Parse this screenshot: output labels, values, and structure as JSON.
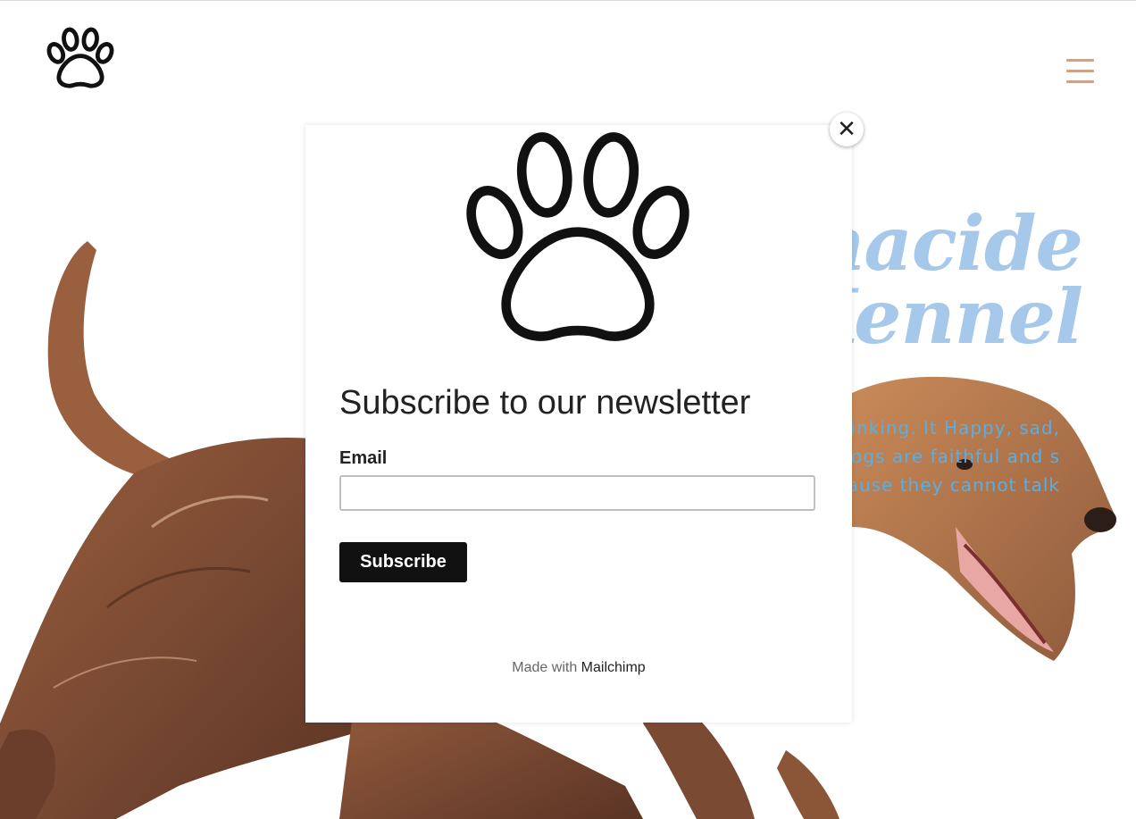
{
  "header": {
    "logo_icon": "paw-icon",
    "menu_icon": "hamburger-menu-icon",
    "menu_color": "#c9a48a"
  },
  "hero": {
    "title": "macide\nKennel",
    "description": "at a dog is thinking. It Happy, sad, cross, and , dogs are faithful and s because they cannot talk",
    "title_color": "#a6c8ea",
    "text_color": "#5aaee0"
  },
  "modal": {
    "logo_icon": "paw-icon",
    "title": "Subscribe to our newsletter",
    "email_label": "Email",
    "email_value": "",
    "email_placeholder": "",
    "subscribe_label": "Subscribe",
    "made_with_prefix": "Made with",
    "made_with_brand": "Mailchimp",
    "close_icon": "close-icon",
    "close_glyph": "✕"
  }
}
